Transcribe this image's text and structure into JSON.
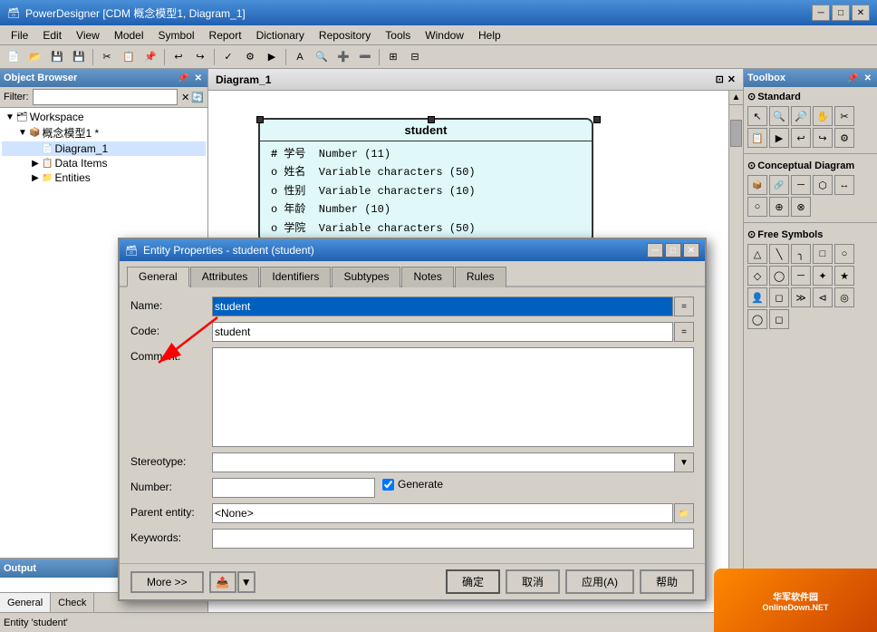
{
  "app": {
    "title": "PowerDesigner [CDM 概念模型1, Diagram_1]",
    "icon": "PD"
  },
  "menu": {
    "items": [
      "File",
      "Edit",
      "View",
      "Model",
      "Symbol",
      "Report",
      "Dictionary",
      "Repository",
      "Tools",
      "Window",
      "Help"
    ]
  },
  "leftPanel": {
    "title": "Object Browser",
    "filter_label": "Filter:",
    "tree": [
      {
        "label": "Workspace",
        "level": 0,
        "expanded": true,
        "icon": "🗂"
      },
      {
        "label": "概念模型1 *",
        "level": 1,
        "expanded": true,
        "icon": "📦"
      },
      {
        "label": "Diagram_1",
        "level": 2,
        "expanded": false,
        "icon": "📄"
      },
      {
        "label": "Data Items",
        "level": 2,
        "expanded": false,
        "icon": "📋"
      },
      {
        "label": "Entities",
        "level": 2,
        "expanded": false,
        "icon": "📁"
      }
    ]
  },
  "diagram": {
    "title": "Diagram_1",
    "entity": {
      "name": "student",
      "attributes": [
        {
          "key": "#",
          "name": "学号",
          "type": "Number (11)"
        },
        {
          "key": "o",
          "name": "姓名",
          "type": "Variable characters (50)"
        },
        {
          "key": "o",
          "name": "性别",
          "type": "Variable characters (10)"
        },
        {
          "key": "o",
          "name": "年龄",
          "type": "Number (10)"
        },
        {
          "key": "o",
          "name": "学院",
          "type": "Variable characters (50)"
        }
      ]
    }
  },
  "toolbox": {
    "title": "Toolbox",
    "sections": [
      {
        "name": "Standard",
        "tools": [
          "↖",
          "🔍",
          "➕",
          "🔎",
          "✋",
          "⊞",
          "✂",
          "📋",
          "▶",
          "↩",
          "↪",
          "⚙",
          "⚙"
        ]
      },
      {
        "name": "Conceptual Diagram",
        "tools": [
          "📦",
          "🔗",
          "─",
          "│",
          "⬡",
          "↔",
          "○",
          "⊕",
          "⊗",
          "△",
          "▷"
        ]
      },
      {
        "name": "Free Symbols",
        "tools": [
          "△",
          "╲",
          "╮",
          "□",
          "○",
          "◇",
          "◯",
          "─",
          "✦",
          "★",
          "☆",
          "◻",
          "╱",
          "╲",
          "□",
          "◯",
          "◻",
          "◻",
          "║",
          "◻",
          "≫",
          "⊲",
          "◎",
          "◯",
          "◻"
        ]
      }
    ]
  },
  "outputPanel": {
    "title": "Output"
  },
  "bottomTabs": {
    "tabs": [
      "General",
      "Check"
    ]
  },
  "statusBar": {
    "message": "Entity 'student'"
  },
  "modal": {
    "title": "Entity Properties - student (student)",
    "tabs": [
      "General",
      "Attributes",
      "Identifiers",
      "Subtypes",
      "Notes",
      "Rules"
    ],
    "activeTab": "General",
    "form": {
      "name_label": "Name:",
      "name_value": "student",
      "code_label": "Code:",
      "code_value": "student",
      "comment_label": "Comment:",
      "comment_value": "",
      "stereotype_label": "Stereotype:",
      "stereotype_value": "",
      "number_label": "Number:",
      "number_value": "",
      "generate_label": "Generate",
      "generate_checked": true,
      "parent_label": "Parent entity:",
      "parent_value": "<None>",
      "keywords_label": "Keywords:",
      "keywords_value": ""
    },
    "buttons": {
      "more": "More >>",
      "ok": "确定",
      "cancel": "取消",
      "apply": "应用(A)",
      "help": "帮助"
    }
  },
  "arrow": {
    "label": ""
  }
}
